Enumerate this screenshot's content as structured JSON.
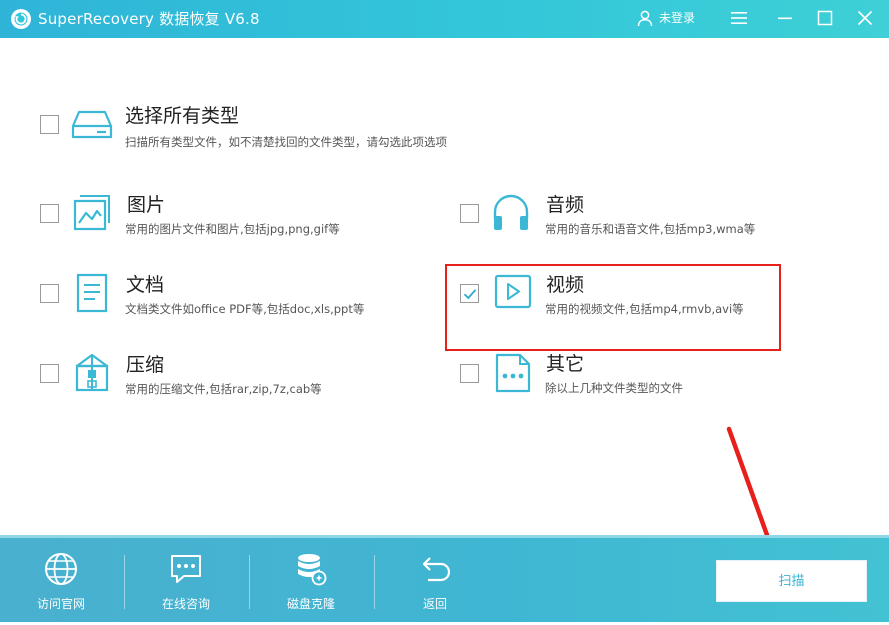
{
  "window": {
    "title": "SuperRecovery 数据恢复 V6.8",
    "user_label": "未登录"
  },
  "options": {
    "all": {
      "title": "选择所有类型",
      "desc": "扫描所有类型文件，如不清楚找回的文件类型，请勾选此项选项",
      "checked": false,
      "icon": "drive-icon"
    },
    "image": {
      "title": "图片",
      "desc": "常用的图片文件和图片,包括jpg,png,gif等",
      "checked": false,
      "icon": "image-icon"
    },
    "audio": {
      "title": "音频",
      "desc": "常用的音乐和语音文件,包括mp3,wma等",
      "checked": false,
      "icon": "headphones-icon"
    },
    "doc": {
      "title": "文档",
      "desc": "文档类文件如office PDF等,包括doc,xls,ppt等",
      "checked": false,
      "icon": "document-icon"
    },
    "video": {
      "title": "视频",
      "desc": "常用的视频文件,包括mp4,rmvb,avi等",
      "checked": true,
      "icon": "video-play-icon"
    },
    "archive": {
      "title": "压缩",
      "desc": "常用的压缩文件,包括rar,zip,7z,cab等",
      "checked": false,
      "icon": "archive-icon"
    },
    "other": {
      "title": "其它",
      "desc": "除以上几种文件类型的文件",
      "checked": false,
      "icon": "more-file-icon"
    }
  },
  "toolbar": {
    "website": "访问官网",
    "consult": "在线咨询",
    "clone": "磁盘克隆",
    "back": "返回",
    "scan": "扫描"
  },
  "colors": {
    "accent": "#33c6d9",
    "icon": "#3ab8d6",
    "highlight": "#e8201c"
  }
}
